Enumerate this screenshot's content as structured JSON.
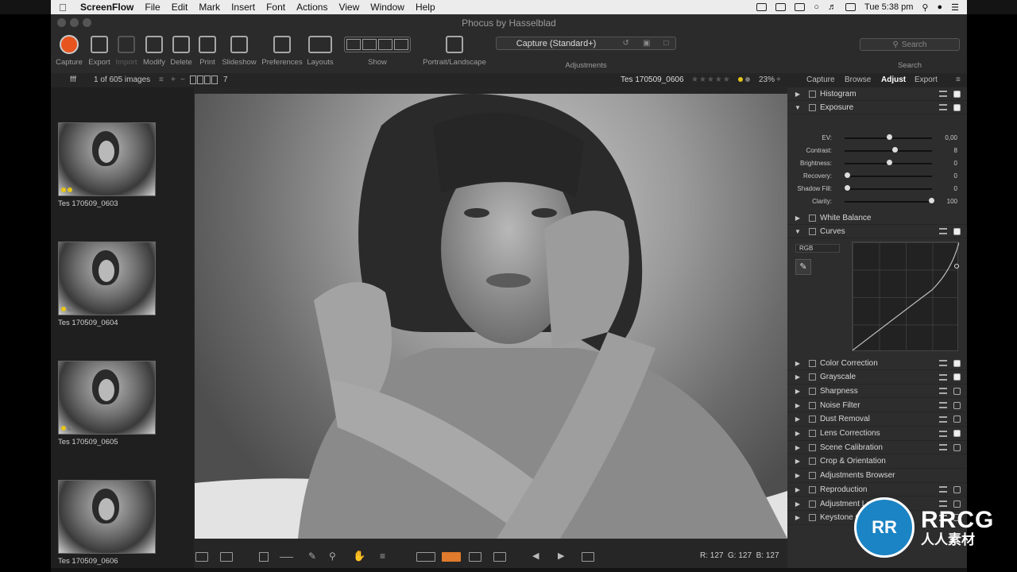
{
  "menubar": {
    "app_name": "ScreenFlow",
    "items": [
      "File",
      "Edit",
      "Mark",
      "Insert",
      "Font",
      "Actions",
      "View",
      "Window",
      "Help"
    ],
    "clock": "Tue 5:38 pm"
  },
  "window": {
    "title": "Phocus by Hasselblad"
  },
  "toolbar": {
    "capture": "Capture",
    "export": "Export",
    "import": "Import",
    "modify": "Modify",
    "delete": "Delete",
    "print": "Print",
    "slideshow": "Slideshow",
    "preferences": "Preferences",
    "layouts": "Layouts",
    "show": "Show",
    "portrait_landscape": "Portrait/Landscape",
    "adjustments_preset": "Capture (Standard+)",
    "adjustments_label": "Adjustments",
    "search_placeholder": "Search",
    "search_label": "Search"
  },
  "browser_bar": {
    "folder": "fff",
    "count": "1 of 605 images",
    "columns": "7",
    "image_name": "Tes 170509_0606",
    "zoom": "23%"
  },
  "thumbnails": [
    {
      "name": "Tes 170509_0603"
    },
    {
      "name": "Tes 170509_0604"
    },
    {
      "name": "Tes 170509_0605"
    },
    {
      "name": "Tes 170509_0606"
    }
  ],
  "panel_tabs": [
    "Capture",
    "Browse",
    "Adjust",
    "Export"
  ],
  "tools": {
    "histogram": "Histogram",
    "exposure": "Exposure",
    "white_balance": "White Balance",
    "curves": "Curves",
    "curve_channel": "RGB",
    "list": [
      {
        "name": "Color Correction",
        "checked": true,
        "has_check": true
      },
      {
        "name": "Grayscale",
        "checked": true,
        "has_check": true
      },
      {
        "name": "Sharpness",
        "checked": false,
        "has_check": true
      },
      {
        "name": "Noise Filter",
        "checked": false,
        "has_check": true
      },
      {
        "name": "Dust Removal",
        "checked": false,
        "has_check": true
      },
      {
        "name": "Lens Corrections",
        "checked": true,
        "has_check": true
      },
      {
        "name": "Scene Calibration",
        "checked": false,
        "has_check": true
      },
      {
        "name": "Crop & Orientation",
        "checked": false,
        "has_check": false
      },
      {
        "name": "Adjustments Browser",
        "checked": false,
        "has_check": false
      },
      {
        "name": "Reproduction",
        "checked": false,
        "has_check": true
      },
      {
        "name": "Adjustment Layers",
        "checked": false,
        "has_check": true
      },
      {
        "name": "Keystone Correction",
        "checked": false,
        "has_check": true
      }
    ]
  },
  "exposure_sliders": [
    {
      "label": "EV:",
      "value": "0,00",
      "pos": 0.5
    },
    {
      "label": "Contrast:",
      "value": "8",
      "pos": 0.57
    },
    {
      "label": "Brightness:",
      "value": "0",
      "pos": 0.5
    },
    {
      "label": "Recovery:",
      "value": "0",
      "pos": 0.0
    },
    {
      "label": "Shadow Fill:",
      "value": "0",
      "pos": 0.0
    },
    {
      "label": "Clarity:",
      "value": "100",
      "pos": 1.0
    }
  ],
  "pixel_readout": {
    "r": "R: 127",
    "g": "G: 127",
    "b": "B: 127"
  },
  "watermark": {
    "primary": "RRCG",
    "secondary": "人人素材"
  },
  "colors": {
    "capture": "#e8541e",
    "rating_dot": "#e6c619",
    "accent_orange": "#e07a2c"
  }
}
